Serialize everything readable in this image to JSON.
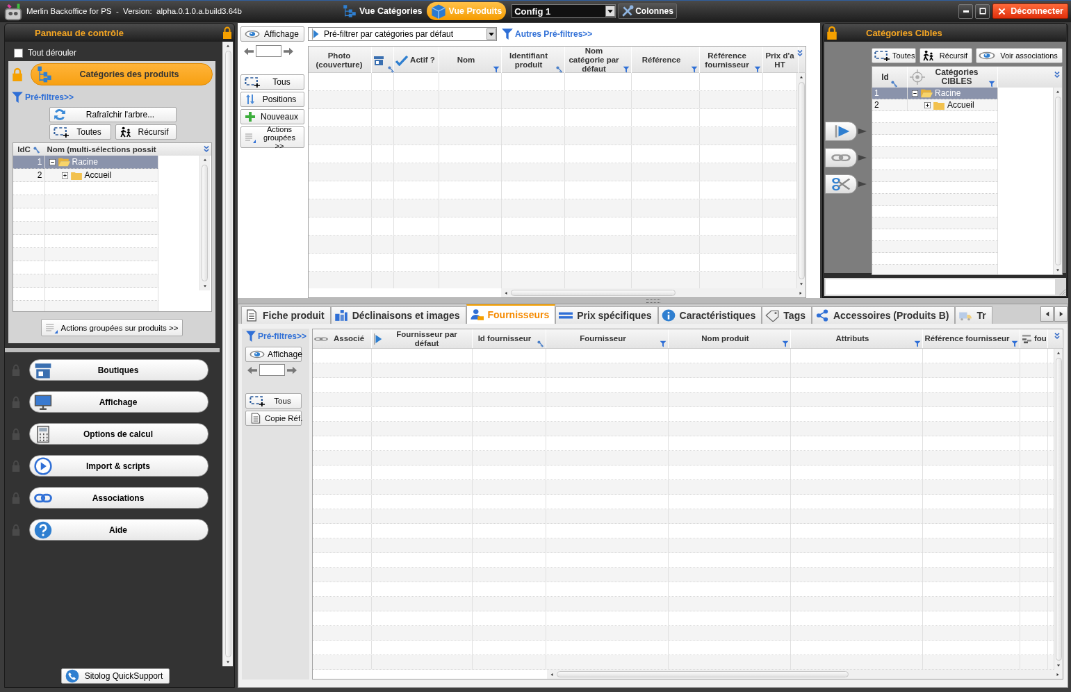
{
  "window": {
    "title": "Merlin Backoffice for PS  -  Version:  alpha.0.1.0.a.build3.64b"
  },
  "toolbar": {
    "views": [
      {
        "label": "Vue Catégories",
        "selected": false
      },
      {
        "label": "Vue Produits",
        "selected": true
      }
    ],
    "config": "Config 1",
    "columns_button": "Colonnes",
    "logout_button": "Déconnecter"
  },
  "control_panel": {
    "title": "Panneau de contrôle",
    "expand_all": {
      "label": "Tout dérouler",
      "checked": false
    },
    "categories_button": "Catégories des produits",
    "prefilters_link": "Pré-filtres>>",
    "refresh_button": "Rafraîchir l'arbre...",
    "select_buttons": [
      "Toutes",
      "Récursif"
    ],
    "tree": {
      "columns": [
        "IdC",
        "Nom  (multi-sélections possit"
      ],
      "rows": [
        {
          "id": "1",
          "name": "Racine",
          "selected": true,
          "expanded": true,
          "children": [
            {
              "id": "2",
              "name": "Accueil",
              "selected": false,
              "expanded": false
            }
          ]
        }
      ]
    },
    "bulk_actions_button": "Actions groupées sur produits >>"
  },
  "menu": [
    "Boutiques",
    "Affichage",
    "Options de calcul",
    "Import & scripts",
    "Associations",
    "Aide"
  ],
  "support_button": "Sitolog QuickSupport",
  "products": {
    "display_button": "Affichage",
    "prefilter_select": "Pré-filtrer par catégories par défaut",
    "other_prefilters_link": "Autres Pré-filtres>>",
    "side_buttons": [
      "Tous",
      "Positions",
      "Nouveaux",
      "Actions groupées >>"
    ],
    "table": {
      "columns": [
        {
          "label": "Photo (couverture)",
          "kind": "plain"
        },
        {
          "kind": "shop"
        },
        {
          "label": "Actif ?",
          "kind": "check"
        },
        {
          "label": "Nom",
          "kind": "filter"
        },
        {
          "label": "Identifiant produit",
          "kind": "key"
        },
        {
          "label": "Nom catégorie par défaut",
          "kind": "filter"
        },
        {
          "label": "Référence",
          "kind": "filter"
        },
        {
          "label": "Référence fournisseur",
          "kind": "filter"
        },
        {
          "label": "Prix d'a HT",
          "kind": "plain"
        }
      ]
    }
  },
  "target_categories": {
    "title": "Catégories Cibles",
    "buttons": [
      "Toutes",
      "Récursif",
      "Voir associations"
    ],
    "tree": {
      "columns": [
        "Id",
        "Catégories CIBLES"
      ],
      "rows": [
        {
          "id": "1",
          "name": "Racine",
          "selected": true,
          "expanded": true,
          "children": [
            {
              "id": "2",
              "name": "Accueil",
              "selected": false,
              "expanded": false
            }
          ]
        }
      ]
    }
  },
  "details": {
    "tabs": [
      {
        "label": "Fiche produit",
        "selected": false
      },
      {
        "label": "Déclinaisons et images",
        "selected": false
      },
      {
        "label": "Fournisseurs",
        "selected": true
      },
      {
        "label": "Prix spécifiques",
        "selected": false
      },
      {
        "label": "Caractéristiques",
        "selected": false
      },
      {
        "label": "Tags",
        "selected": false
      },
      {
        "label": "Accessoires (Produits B)",
        "selected": false
      },
      {
        "label": "Tr",
        "selected": false
      }
    ],
    "prefilters_link": "Pré-filtres>>",
    "display_button": "Affichage",
    "side_buttons": [
      "Tous",
      "Copie Réf."
    ],
    "table": {
      "columns": [
        {
          "label": "Associé",
          "kind": "link"
        },
        {
          "label": "Fournisseur par défaut",
          "kind": "flag"
        },
        {
          "label": "Id fournisseur",
          "kind": "key"
        },
        {
          "label": "Fournisseur",
          "kind": "filter"
        },
        {
          "label": "Nom produit",
          "kind": "filter"
        },
        {
          "label": "Attributs",
          "kind": "filter"
        },
        {
          "label": "Référence fournisseur",
          "kind": "filter"
        },
        {
          "label": "fou",
          "kind": "stack"
        }
      ]
    }
  }
}
